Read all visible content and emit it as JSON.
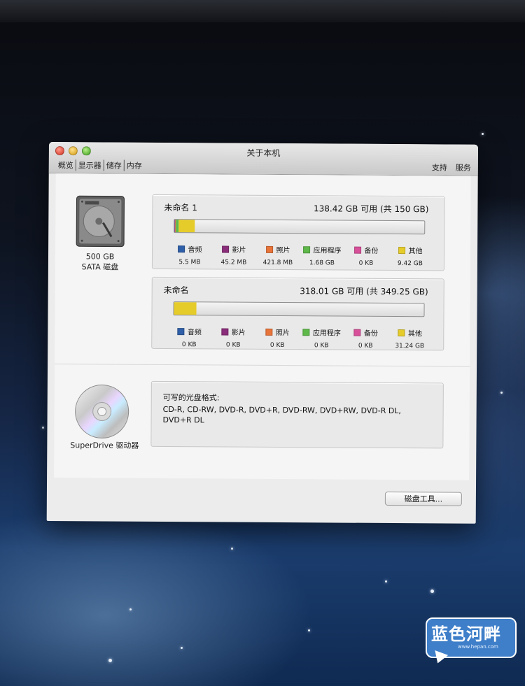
{
  "window": {
    "title": "关于本机",
    "tabs": [
      "概览",
      "显示器",
      "储存",
      "内存"
    ],
    "right_links": [
      "支持",
      "服务"
    ]
  },
  "disk": {
    "capacity": "500 GB",
    "type": "SATA 磁盘"
  },
  "volumes": [
    {
      "name": "未命名 1",
      "free": "138.42 GB 可用 (共 150 GB)",
      "categories": [
        {
          "label": "音频",
          "size": "5.5 MB",
          "color": "#2f5fa8"
        },
        {
          "label": "影片",
          "size": "45.2 MB",
          "color": "#8a2d7a"
        },
        {
          "label": "照片",
          "size": "421.8 MB",
          "color": "#e8743a"
        },
        {
          "label": "应用程序",
          "size": "1.68 GB",
          "color": "#5fb94a"
        },
        {
          "label": "备份",
          "size": "0 KB",
          "color": "#d8509a"
        },
        {
          "label": "其他",
          "size": "9.42 GB",
          "color": "#e6cc2a"
        }
      ],
      "usage": {
        "audio": 0.001,
        "movies": 0.003,
        "photos": 0.003,
        "apps": 0.011,
        "other": 0.063
      }
    },
    {
      "name": "未命名",
      "free": "318.01 GB 可用 (共 349.25 GB)",
      "categories": [
        {
          "label": "音频",
          "size": "0 KB",
          "color": "#2f5fa8"
        },
        {
          "label": "影片",
          "size": "0 KB",
          "color": "#8a2d7a"
        },
        {
          "label": "照片",
          "size": "0 KB",
          "color": "#e8743a"
        },
        {
          "label": "应用程序",
          "size": "0 KB",
          "color": "#5fb94a"
        },
        {
          "label": "备份",
          "size": "0 KB",
          "color": "#d8509a"
        },
        {
          "label": "其他",
          "size": "31.24 GB",
          "color": "#e6cc2a"
        }
      ],
      "usage": {
        "audio": 0,
        "movies": 0,
        "photos": 0,
        "apps": 0,
        "other": 0.089
      }
    }
  ],
  "optical": {
    "drive_name": "SuperDrive 驱动器",
    "formats_title": "可写的光盘格式:",
    "formats": "CD-R, CD-RW, DVD-R, DVD+R, DVD-RW, DVD+RW, DVD-R DL, DVD+R DL"
  },
  "buttons": {
    "disk_utility": "磁盘工具..."
  },
  "watermark": {
    "text": "蓝色河畔",
    "url": "www.hepan.com"
  }
}
